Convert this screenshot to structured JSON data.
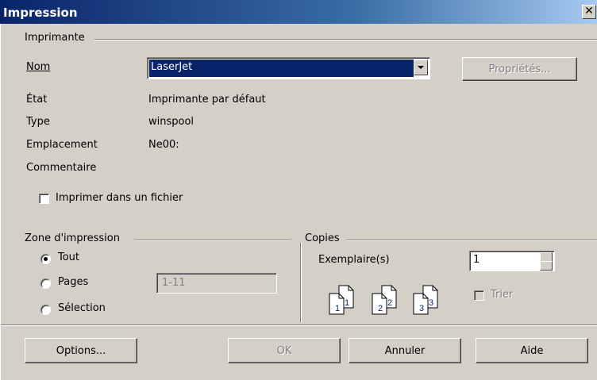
{
  "window": {
    "title": "Impression",
    "close_glyph": "✕"
  },
  "printer": {
    "group_label": "Imprimante",
    "name_label": "Nom",
    "name_value": "LaserJet",
    "properties_button": "Propriétés...",
    "status_label": "État",
    "status_value": "Imprimante par défaut",
    "type_label": "Type",
    "type_value": "winspool",
    "location_label": "Emplacement",
    "location_value": "Ne00:",
    "comment_label": "Commentaire",
    "comment_value": "",
    "print_to_file_label": "Imprimer dans un fichier",
    "print_to_file_checked": false
  },
  "print_range": {
    "group_label": "Zone d'impression",
    "all_label": "Tout",
    "pages_label": "Pages",
    "selection_label": "Sélection",
    "selected": "all",
    "pages_value": "1-11"
  },
  "copies": {
    "group_label": "Copies",
    "copies_label": "Exemplaire(s)",
    "copies_value": "1",
    "collate_label": "Trier",
    "collate_checked": false,
    "collate_icon_numbers": [
      "1",
      "1",
      "2",
      "2",
      "3",
      "3"
    ]
  },
  "buttons": {
    "options": "Options...",
    "ok": "OK",
    "cancel": "Annuler",
    "help": "Aide"
  },
  "colors": {
    "titlebar_start": "#0a246a",
    "titlebar_end": "#a6caf0",
    "dialog_bg": "#d4d0c8",
    "selection_bg": "#0a246a"
  }
}
